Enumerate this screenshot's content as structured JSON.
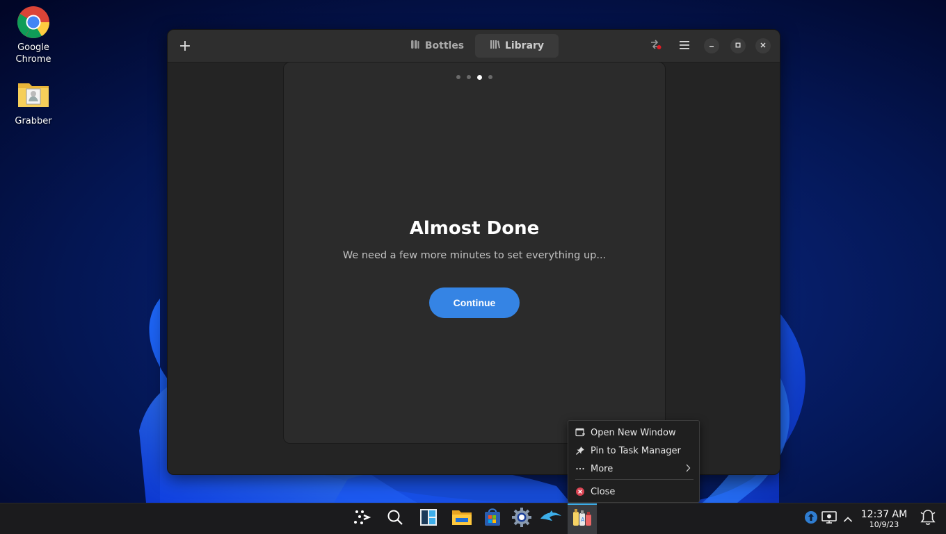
{
  "desktop": {
    "icons": [
      {
        "label_line1": "Google",
        "label_line2": "Chrome"
      },
      {
        "label_line1": "Grabber"
      }
    ]
  },
  "window": {
    "tabs": [
      {
        "label": "Bottles",
        "active": false
      },
      {
        "label": "Library",
        "active": true
      }
    ],
    "onboarding": {
      "page_count": 4,
      "current_page": 3,
      "title": "Almost Done",
      "subtitle": "We need a few more minutes to set everything up...",
      "continue_label": "Continue"
    }
  },
  "context_menu": {
    "items": [
      {
        "label": "Open New Window",
        "icon": "new-window-icon"
      },
      {
        "label": "Pin to Task Manager",
        "icon": "pin-icon"
      },
      {
        "label": "More",
        "icon": "ellipsis-icon",
        "submenu": true
      },
      {
        "label": "Close",
        "icon": "close-circle-icon"
      }
    ]
  },
  "taskbar": {
    "clock": {
      "time": "12:37 AM",
      "date": "10/9/23"
    }
  },
  "colors": {
    "accent": "#3584e4",
    "taskbar_highlight": "#3daee9",
    "window_bg": "#242424"
  }
}
